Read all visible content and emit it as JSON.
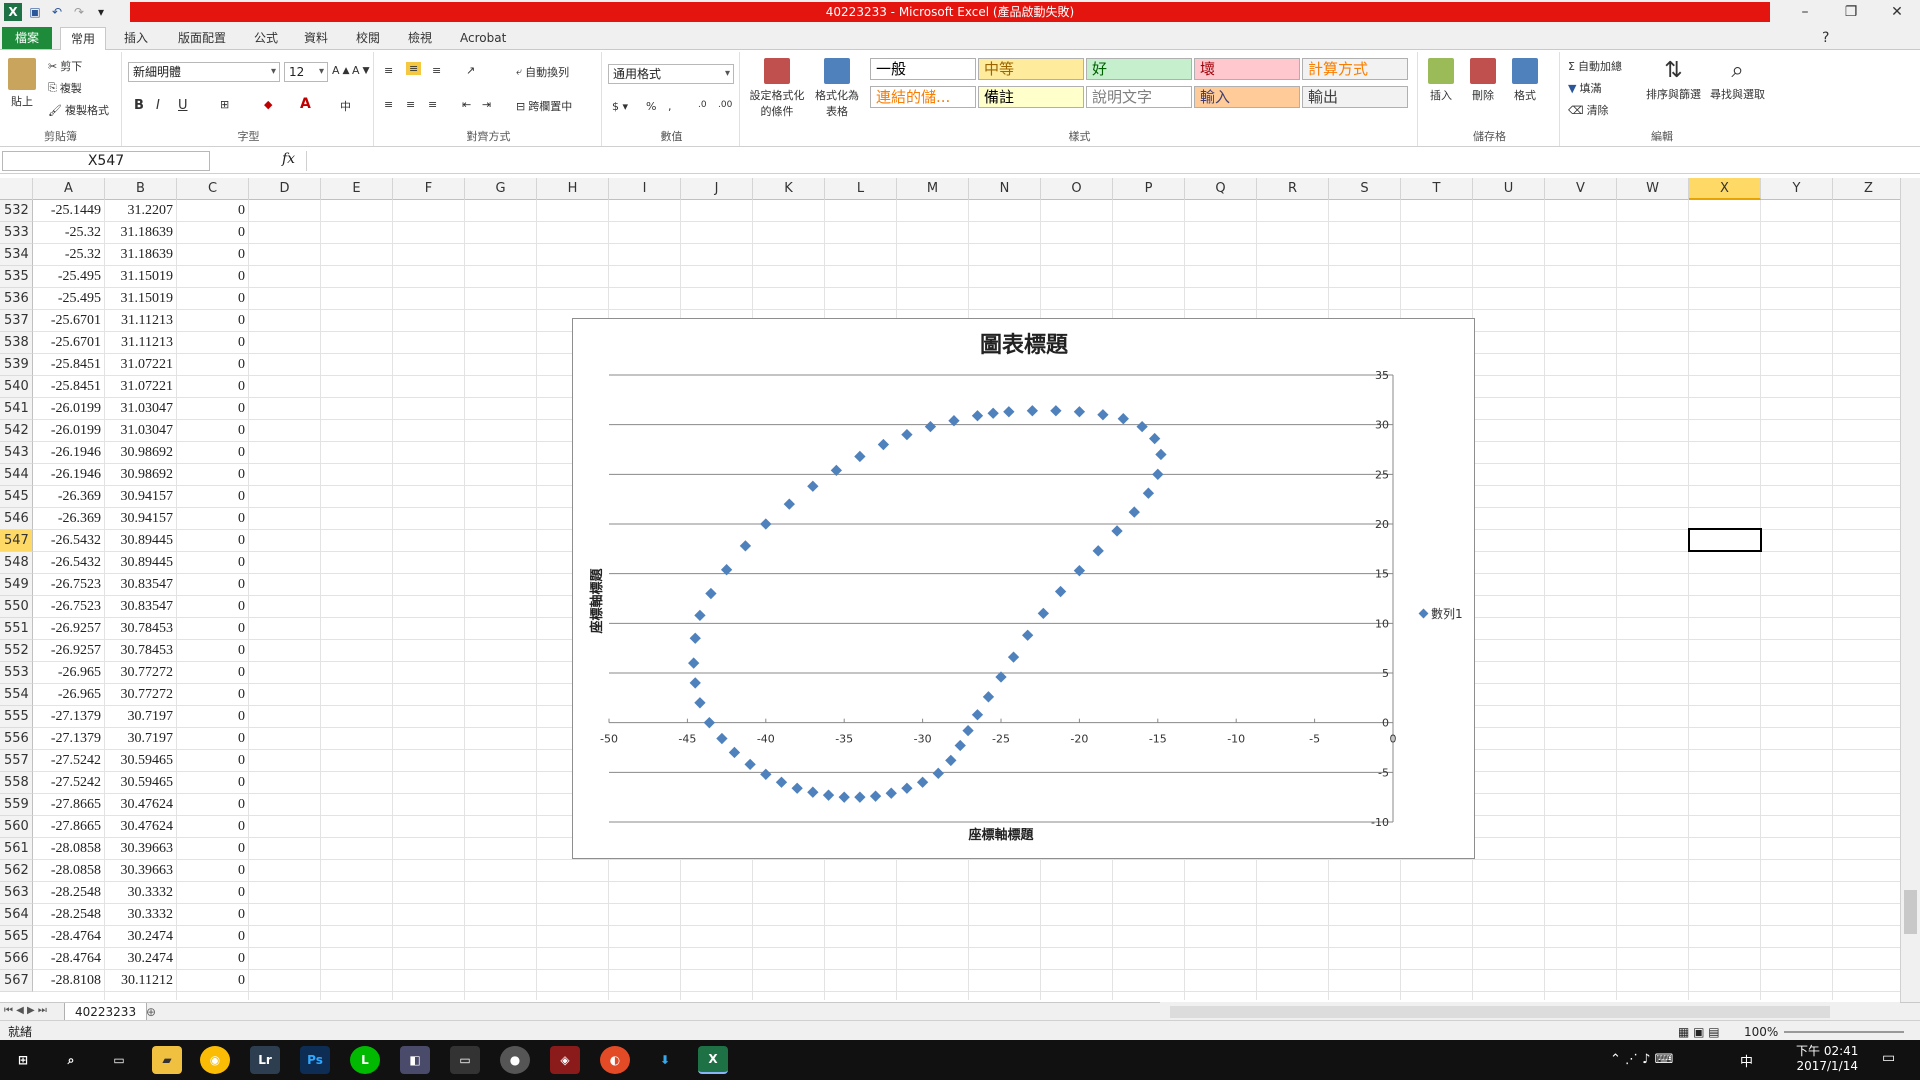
{
  "window": {
    "title": "40223233 - Microsoft Excel (產品啟動失敗)"
  },
  "ribbon_tabs": [
    "檔案",
    "常用",
    "插入",
    "版面配置",
    "公式",
    "資料",
    "校閱",
    "檢視",
    "Acrobat"
  ],
  "clipboard": {
    "paste": "貼上",
    "cut": "剪下",
    "copy": "複製",
    "format_painter": "複製格式",
    "label": "剪貼簿"
  },
  "font": {
    "name": "新細明體",
    "size": "12",
    "label": "字型"
  },
  "alignment": {
    "wrap": "自動換列",
    "merge": "跨欄置中",
    "label": "對齊方式"
  },
  "number": {
    "format": "通用格式",
    "label": "數值"
  },
  "styles": {
    "conditional": "設定格式化的條件",
    "as_table": "格式化為表格",
    "cells": [
      {
        "text": "一般",
        "bg": "#ffffff",
        "fg": "#000000"
      },
      {
        "text": "中等",
        "bg": "#ffeb9c",
        "fg": "#9c6500"
      },
      {
        "text": "好",
        "bg": "#c6efce",
        "fg": "#006100"
      },
      {
        "text": "壞",
        "bg": "#ffc7ce",
        "fg": "#9c0006"
      },
      {
        "text": "計算方式",
        "bg": "#f2f2f2",
        "fg": "#fa7d00"
      },
      {
        "text": "連結的儲...",
        "bg": "#ffffff",
        "fg": "#fa7d00"
      },
      {
        "text": "備註",
        "bg": "#ffffcc",
        "fg": "#000000"
      },
      {
        "text": "說明文字",
        "bg": "#ffffff",
        "fg": "#7f7f7f"
      },
      {
        "text": "輸入",
        "bg": "#ffcc99",
        "fg": "#3f3f76"
      },
      {
        "text": "輸出",
        "bg": "#f2f2f2",
        "fg": "#3f3f3f"
      }
    ],
    "label": "樣式"
  },
  "cells_group": {
    "insert": "插入",
    "delete": "刪除",
    "format": "格式",
    "label": "儲存格"
  },
  "editing": {
    "autosum": "自動加總",
    "fill": "填滿",
    "clear": "清除",
    "sort": "排序與篩選",
    "find": "尋找與選取",
    "label": "編輯"
  },
  "formula_bar": {
    "name_box": "X547",
    "fx": "fx",
    "formula": ""
  },
  "columns": [
    "A",
    "B",
    "C",
    "D",
    "E",
    "F",
    "G",
    "H",
    "I",
    "J",
    "K",
    "L",
    "M",
    "N",
    "O",
    "P",
    "Q",
    "R",
    "S",
    "T",
    "U",
    "V",
    "W",
    "X",
    "Y",
    "Z"
  ],
  "selected_column": "X",
  "selected_row": "547",
  "rows": [
    {
      "n": "532",
      "a": "-25.1449",
      "b": "31.2207",
      "c": "0"
    },
    {
      "n": "533",
      "a": "-25.32",
      "b": "31.18639",
      "c": "0"
    },
    {
      "n": "534",
      "a": "-25.32",
      "b": "31.18639",
      "c": "0"
    },
    {
      "n": "535",
      "a": "-25.495",
      "b": "31.15019",
      "c": "0"
    },
    {
      "n": "536",
      "a": "-25.495",
      "b": "31.15019",
      "c": "0"
    },
    {
      "n": "537",
      "a": "-25.6701",
      "b": "31.11213",
      "c": "0"
    },
    {
      "n": "538",
      "a": "-25.6701",
      "b": "31.11213",
      "c": "0"
    },
    {
      "n": "539",
      "a": "-25.8451",
      "b": "31.07221",
      "c": "0"
    },
    {
      "n": "540",
      "a": "-25.8451",
      "b": "31.07221",
      "c": "0"
    },
    {
      "n": "541",
      "a": "-26.0199",
      "b": "31.03047",
      "c": "0"
    },
    {
      "n": "542",
      "a": "-26.0199",
      "b": "31.03047",
      "c": "0"
    },
    {
      "n": "543",
      "a": "-26.1946",
      "b": "30.98692",
      "c": "0"
    },
    {
      "n": "544",
      "a": "-26.1946",
      "b": "30.98692",
      "c": "0"
    },
    {
      "n": "545",
      "a": "-26.369",
      "b": "30.94157",
      "c": "0"
    },
    {
      "n": "546",
      "a": "-26.369",
      "b": "30.94157",
      "c": "0"
    },
    {
      "n": "547",
      "a": "-26.5432",
      "b": "30.89445",
      "c": "0"
    },
    {
      "n": "548",
      "a": "-26.5432",
      "b": "30.89445",
      "c": "0"
    },
    {
      "n": "549",
      "a": "-26.7523",
      "b": "30.83547",
      "c": "0"
    },
    {
      "n": "550",
      "a": "-26.7523",
      "b": "30.83547",
      "c": "0"
    },
    {
      "n": "551",
      "a": "-26.9257",
      "b": "30.78453",
      "c": "0"
    },
    {
      "n": "552",
      "a": "-26.9257",
      "b": "30.78453",
      "c": "0"
    },
    {
      "n": "553",
      "a": "-26.965",
      "b": "30.77272",
      "c": "0"
    },
    {
      "n": "554",
      "a": "-26.965",
      "b": "30.77272",
      "c": "0"
    },
    {
      "n": "555",
      "a": "-27.1379",
      "b": "30.7197",
      "c": "0"
    },
    {
      "n": "556",
      "a": "-27.1379",
      "b": "30.7197",
      "c": "0"
    },
    {
      "n": "557",
      "a": "-27.5242",
      "b": "30.59465",
      "c": "0"
    },
    {
      "n": "558",
      "a": "-27.5242",
      "b": "30.59465",
      "c": "0"
    },
    {
      "n": "559",
      "a": "-27.8665",
      "b": "30.47624",
      "c": "0"
    },
    {
      "n": "560",
      "a": "-27.8665",
      "b": "30.47624",
      "c": "0"
    },
    {
      "n": "561",
      "a": "-28.0858",
      "b": "30.39663",
      "c": "0"
    },
    {
      "n": "562",
      "a": "-28.0858",
      "b": "30.39663",
      "c": "0"
    },
    {
      "n": "563",
      "a": "-28.2548",
      "b": "30.3332",
      "c": "0"
    },
    {
      "n": "564",
      "a": "-28.2548",
      "b": "30.3332",
      "c": "0"
    },
    {
      "n": "565",
      "a": "-28.4764",
      "b": "30.2474",
      "c": "0"
    },
    {
      "n": "566",
      "a": "-28.4764",
      "b": "30.2474",
      "c": "0"
    },
    {
      "n": "567",
      "a": "-28.8108",
      "b": "30.11212",
      "c": "0"
    }
  ],
  "chart_data": {
    "type": "scatter",
    "title": "圖表標題",
    "xlabel": "座標軸標題",
    "ylabel": "座標軸標題",
    "xlim": [
      -50,
      0
    ],
    "ylim": [
      -10,
      35
    ],
    "xticks": [
      "-50",
      "-45",
      "-40",
      "-35",
      "-30",
      "-25",
      "-20",
      "-15",
      "-10",
      "-5",
      "0"
    ],
    "yticks": [
      "35",
      "30",
      "25",
      "20",
      "15",
      "10",
      "5",
      "0",
      "-5",
      "-10"
    ],
    "grid": "horizontal",
    "legend_position": "right",
    "series": [
      {
        "name": "數列1",
        "color": "#4f81bd",
        "points": [
          [
            -44.5,
            8.5
          ],
          [
            -44.6,
            6
          ],
          [
            -44.5,
            4
          ],
          [
            -44.2,
            2
          ],
          [
            -43.6,
            0
          ],
          [
            -42.8,
            -1.6
          ],
          [
            -42,
            -3
          ],
          [
            -41,
            -4.2
          ],
          [
            -40,
            -5.2
          ],
          [
            -39,
            -6
          ],
          [
            -38,
            -6.6
          ],
          [
            -37,
            -7
          ],
          [
            -36,
            -7.3
          ],
          [
            -35,
            -7.5
          ],
          [
            -34,
            -7.5
          ],
          [
            -33,
            -7.4
          ],
          [
            -32,
            -7.1
          ],
          [
            -31,
            -6.6
          ],
          [
            -30,
            -6
          ],
          [
            -29,
            -5.1
          ],
          [
            -28.2,
            -3.8
          ],
          [
            -27.6,
            -2.3
          ],
          [
            -27.1,
            -0.8
          ],
          [
            -26.5,
            0.8
          ],
          [
            -25.8,
            2.6
          ],
          [
            -25,
            4.6
          ],
          [
            -24.2,
            6.6
          ],
          [
            -23.3,
            8.8
          ],
          [
            -22.3,
            11
          ],
          [
            -21.2,
            13.2
          ],
          [
            -20,
            15.3
          ],
          [
            -18.8,
            17.3
          ],
          [
            -17.6,
            19.3
          ],
          [
            -16.5,
            21.2
          ],
          [
            -15.6,
            23.1
          ],
          [
            -15,
            25
          ],
          [
            -14.8,
            27
          ],
          [
            -15.2,
            28.6
          ],
          [
            -16,
            29.8
          ],
          [
            -17.2,
            30.6
          ],
          [
            -18.5,
            31
          ],
          [
            -20,
            31.3
          ],
          [
            -21.5,
            31.4
          ],
          [
            -23,
            31.4
          ],
          [
            -24.5,
            31.3
          ],
          [
            -25.5,
            31.15
          ],
          [
            -26.5,
            30.9
          ],
          [
            -28,
            30.4
          ],
          [
            -29.5,
            29.8
          ],
          [
            -31,
            29
          ],
          [
            -32.5,
            28
          ],
          [
            -34,
            26.8
          ],
          [
            -35.5,
            25.4
          ],
          [
            -37,
            23.8
          ],
          [
            -38.5,
            22
          ],
          [
            -40,
            20
          ],
          [
            -41.3,
            17.8
          ],
          [
            -42.5,
            15.4
          ],
          [
            -43.5,
            13
          ],
          [
            -44.2,
            10.8
          ]
        ]
      }
    ]
  },
  "sheet_tab": "40223233",
  "status": {
    "ready": "就緒",
    "zoom": "100%"
  },
  "taskbar": {
    "time": "下午 02:41",
    "date": "2017/1/14",
    "ime": "中"
  }
}
